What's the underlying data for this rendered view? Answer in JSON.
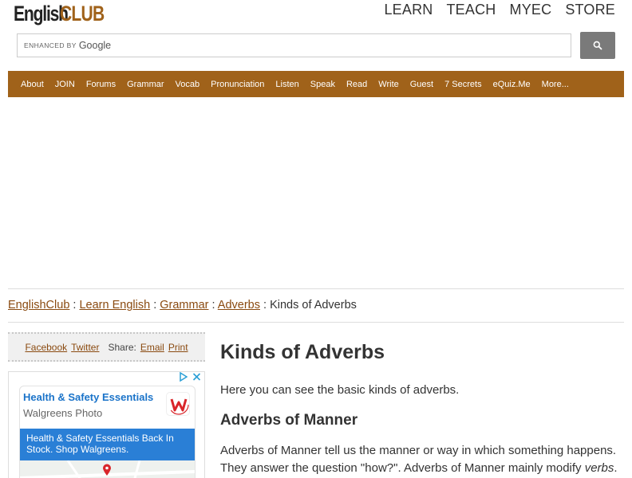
{
  "logo": {
    "part1": "English",
    "part2": "CLUB"
  },
  "topnav": [
    "LEARN",
    "TEACH",
    "MYEC",
    "STORE"
  ],
  "search": {
    "enhanced_label": "ENHANCED BY",
    "brand": "Google"
  },
  "navbar": [
    "About",
    "JOIN",
    "Forums",
    "Grammar",
    "Vocab",
    "Pronunciation",
    "Listen",
    "Speak",
    "Read",
    "Write",
    "Guest",
    "7 Secrets",
    "eQuiz.Me",
    "More..."
  ],
  "breadcrumb": {
    "links": [
      "EnglishClub",
      "Learn English",
      "Grammar",
      "Adverbs"
    ],
    "separator": ":",
    "current": "Kinds of Adverbs"
  },
  "share": {
    "facebook": "Facebook",
    "twitter": "Twitter",
    "share_label": "Share:",
    "email": "Email",
    "print": "Print"
  },
  "ad": {
    "title": "Health & Safety Essentials",
    "subtitle": "Walgreens Photo",
    "body": "Health & Safety Essentials Back In Stock. Shop Walgreens."
  },
  "article": {
    "title": "Kinds of Adverbs",
    "intro": "Here you can see the basic kinds of adverbs.",
    "section1_title": "Adverbs of Manner",
    "section1_text_1": "Adverbs of Manner tell us the manner or way in which something happens. They answer the question \"how?\". Adverbs of Manner mainly modify ",
    "section1_em": "verbs",
    "section1_text_2": "."
  },
  "colors": {
    "brand": "#a0621a",
    "link": "#8a4a10",
    "ad_blue": "#2a7fd6"
  },
  "icons": {
    "search": "search-icon",
    "adchoices": "adchoices-icon",
    "close": "close-icon",
    "map_pin": "map-pin-icon"
  }
}
